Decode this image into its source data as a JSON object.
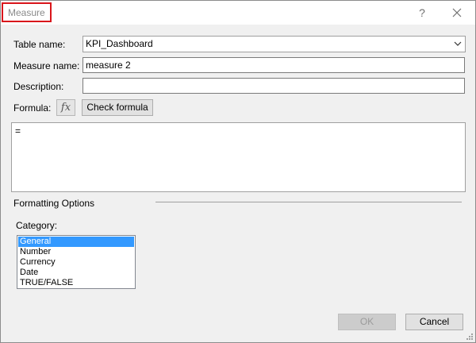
{
  "dialog": {
    "title": "Measure",
    "help_symbol": "?"
  },
  "form": {
    "table_name_label": "Table name:",
    "table_name_value": "KPI_Dashboard",
    "measure_name_label": "Measure name:",
    "measure_name_value": "measure 2",
    "description_label": "Description:",
    "description_value": "",
    "formula_label": "Formula:",
    "fx_symbol": "fx",
    "check_formula_label": "Check formula",
    "formula_value": "="
  },
  "formatting": {
    "section_title": "Formatting Options",
    "category_label": "Category:",
    "categories": [
      "General",
      "Number",
      "Currency",
      "Date",
      "TRUE/FALSE"
    ],
    "selected_category": "General"
  },
  "footer": {
    "ok_label": "OK",
    "cancel_label": "Cancel"
  },
  "colors": {
    "title_highlight": "#d9151b",
    "selection": "#3399ff"
  },
  "icons": {
    "close": "close-icon",
    "dropdown": "chevron-down-icon",
    "function": "function-icon",
    "resize": "resize-grip-icon"
  }
}
